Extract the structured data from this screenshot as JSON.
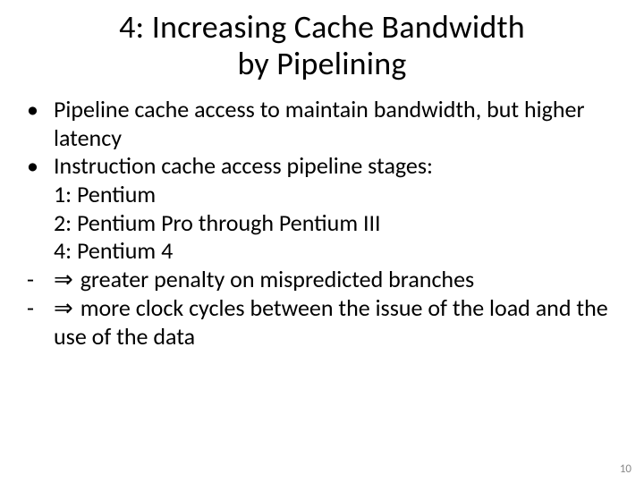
{
  "title_line1": "4: Increasing Cache Bandwidth",
  "title_line2": "by Pipelining",
  "bullets": {
    "b1": "Pipeline cache access to maintain bandwidth, but higher latency",
    "b2": "Instruction cache access pipeline stages:",
    "s1": "1: Pentium",
    "s2": "2: Pentium Pro through Pentium III",
    "s3": "4: Pentium 4",
    "d1_arrow": "⇒",
    "d1": "greater penalty on mispredicted branches",
    "d2_arrow": "⇒",
    "d2": "more clock cycles between the issue of the load and the use of the data"
  },
  "markers": {
    "bullet": "•",
    "dash": "-"
  },
  "page_number": "10"
}
